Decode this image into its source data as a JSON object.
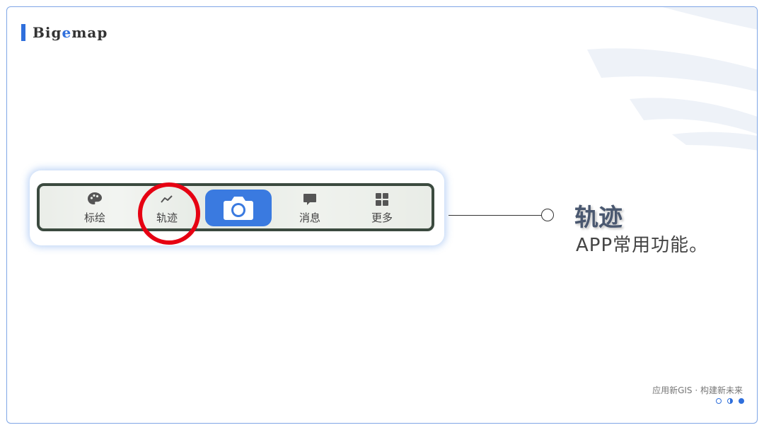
{
  "brand": {
    "prefix": "Big",
    "accent": "e",
    "suffix": "map",
    "accent_color": "#2f6fdc"
  },
  "toolbar": {
    "items": [
      {
        "label": "标绘",
        "icon": "palette-icon"
      },
      {
        "label": "轨迹",
        "icon": "track-line-icon"
      },
      {
        "label": "消息",
        "icon": "chat-bubble-icon"
      },
      {
        "label": "更多",
        "icon": "grid-icon"
      }
    ],
    "center_button": {
      "icon": "camera-icon",
      "color": "#3a7ae0"
    },
    "highlight_color": "#e60012"
  },
  "feature": {
    "title": "轨迹",
    "description": "APP常用功能。"
  },
  "footer": {
    "slogan": "应用新GIS · 构建新未来"
  }
}
